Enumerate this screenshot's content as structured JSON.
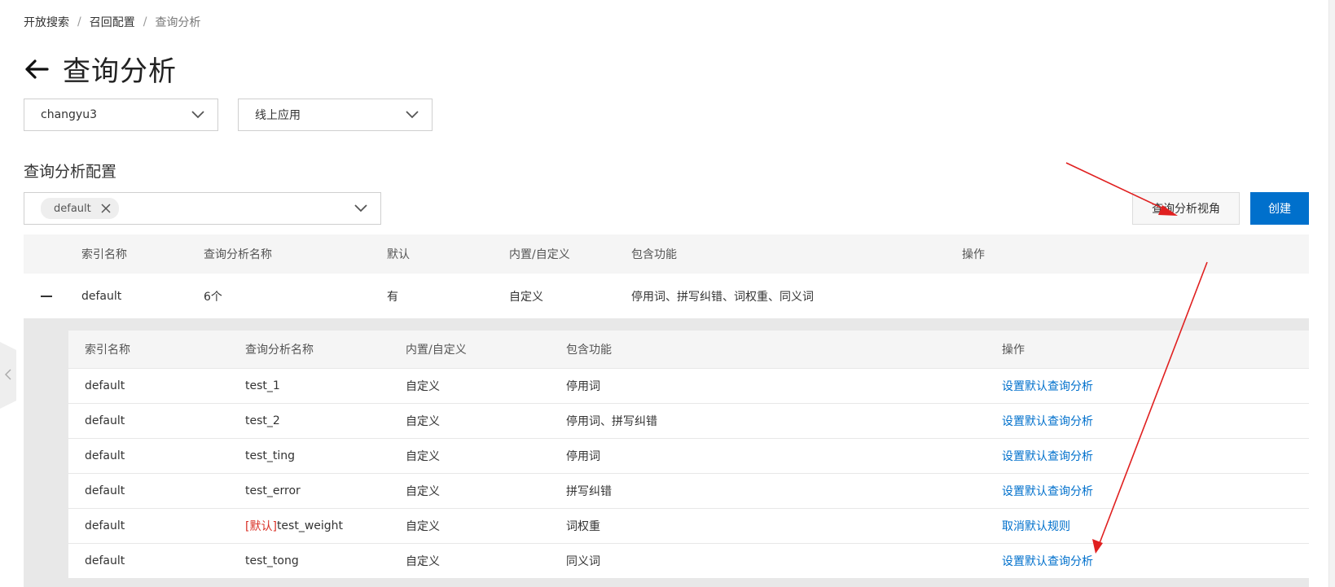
{
  "breadcrumb": {
    "items": [
      "开放搜索",
      "召回配置",
      "查询分析"
    ],
    "separator": "/"
  },
  "page": {
    "title": "查询分析",
    "back_icon": "arrow-left-icon"
  },
  "filters": {
    "app_select": {
      "value": "changyu3"
    },
    "env_select": {
      "value": "线上应用"
    }
  },
  "section": {
    "title": "查询分析配置",
    "index_select": {
      "tag": "default"
    }
  },
  "buttons": {
    "view_label": "查询分析视角",
    "create_label": "创建"
  },
  "outer_table": {
    "headers": [
      "索引名称",
      "查询分析名称",
      "默认",
      "内置/自定义",
      "包含功能",
      "操作"
    ],
    "rows": [
      {
        "index": "default",
        "count": "6个",
        "default": "有",
        "type": "自定义",
        "features": "停用词、拼写纠错、词权重、同义词",
        "action": ""
      }
    ]
  },
  "inner_table": {
    "headers": [
      "索引名称",
      "查询分析名称",
      "内置/自定义",
      "包含功能",
      "操作"
    ],
    "rows": [
      {
        "index": "default",
        "default_mark": "",
        "name": "test_1",
        "type": "自定义",
        "features": "停用词",
        "action": "设置默认查询分析"
      },
      {
        "index": "default",
        "default_mark": "",
        "name": "test_2",
        "type": "自定义",
        "features": "停用词、拼写纠错",
        "action": "设置默认查询分析"
      },
      {
        "index": "default",
        "default_mark": "",
        "name": "test_ting",
        "type": "自定义",
        "features": "停用词",
        "action": "设置默认查询分析"
      },
      {
        "index": "default",
        "default_mark": "",
        "name": "test_error",
        "type": "自定义",
        "features": "拼写纠错",
        "action": "设置默认查询分析"
      },
      {
        "index": "default",
        "default_mark": "[默认]",
        "name": "test_weight",
        "type": "自定义",
        "features": "词权重",
        "action": "取消默认规则"
      },
      {
        "index": "default",
        "default_mark": "",
        "name": "test_tong",
        "type": "自定义",
        "features": "同义词",
        "action": "设置默认查询分析"
      }
    ]
  },
  "colors": {
    "primary": "#0070cc",
    "link": "#0070cc",
    "default_mark": "#d93026",
    "annotation_arrow": "#e02020"
  }
}
